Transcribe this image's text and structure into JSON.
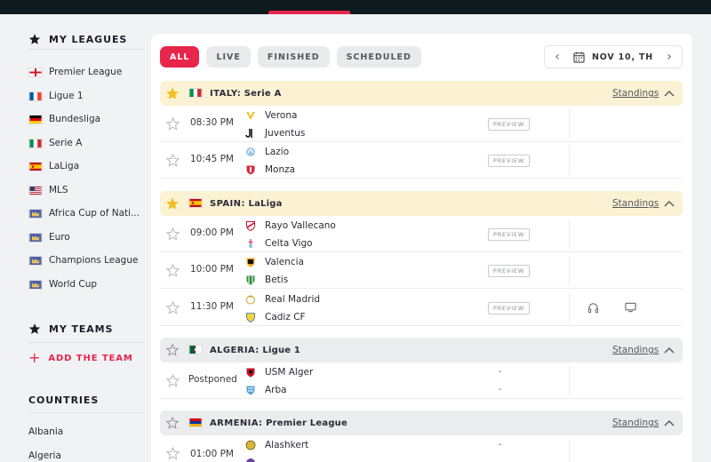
{
  "sidebar": {
    "my_leagues_title": "MY LEAGUES",
    "leagues": [
      {
        "name": "Premier League",
        "flag": "england-flag-icon"
      },
      {
        "name": "Ligue 1",
        "flag": "france-flag-icon"
      },
      {
        "name": "Bundesliga",
        "flag": "germany-flag-icon"
      },
      {
        "name": "Serie A",
        "flag": "italy-flag-icon"
      },
      {
        "name": "LaLiga",
        "flag": "spain-flag-icon"
      },
      {
        "name": "MLS",
        "flag": "usa-flag-icon"
      },
      {
        "name": "Africa Cup of Nati...",
        "flag": "world-flag-icon"
      },
      {
        "name": "Euro",
        "flag": "world-flag-icon"
      },
      {
        "name": "Champions League",
        "flag": "world-flag-icon"
      },
      {
        "name": "World Cup",
        "flag": "world-flag-icon"
      }
    ],
    "my_teams_title": "MY TEAMS",
    "add_team_label": "ADD THE TEAM",
    "countries_title": "COUNTRIES",
    "countries": [
      "Albania",
      "Algeria"
    ]
  },
  "filters": {
    "all": "ALL",
    "live": "LIVE",
    "finished": "FINISHED",
    "scheduled": "SCHEDULED",
    "date": "NOV 10, TH"
  },
  "leagues": [
    {
      "country": "ITALY:",
      "name": "Serie A",
      "standings": "Standings",
      "favorite": true,
      "flag": "italy-flag-icon",
      "matches": [
        {
          "time": "08:30 PM",
          "home": "Verona",
          "away": "Juventus",
          "preview": "PREVIEW"
        },
        {
          "time": "10:45 PM",
          "home": "Lazio",
          "away": "Monza",
          "preview": "PREVIEW"
        }
      ]
    },
    {
      "country": "SPAIN:",
      "name": "LaLiga",
      "standings": "Standings",
      "favorite": true,
      "flag": "spain-flag-icon",
      "matches": [
        {
          "time": "09:00 PM",
          "home": "Rayo Vallecano",
          "away": "Celta Vigo",
          "preview": "PREVIEW"
        },
        {
          "time": "10:00 PM",
          "home": "Valencia",
          "away": "Betis",
          "preview": "PREVIEW"
        },
        {
          "time": "11:30 PM",
          "home": "Real Madrid",
          "away": "Cadiz CF",
          "preview": "PREVIEW"
        }
      ]
    },
    {
      "country": "ALGERIA:",
      "name": "Ligue 1",
      "standings": "Standings",
      "favorite": false,
      "flag": "algeria-flag-icon",
      "matches": [
        {
          "time": "Postponed",
          "home": "USM Alger",
          "away": "Arba",
          "home_score": "-",
          "away_score": "-"
        }
      ]
    },
    {
      "country": "ARMENIA:",
      "name": "Premier League",
      "standings": "Standings",
      "favorite": false,
      "flag": "armenia-flag-icon",
      "matches": [
        {
          "time": "01:00 PM",
          "home": "Alashkert",
          "away": "",
          "home_score": "-"
        }
      ]
    }
  ],
  "colors": {
    "accent": "#e8254a",
    "favorite_bar": "#fbf2d4",
    "league_bar": "#ebeced",
    "star_gold": "#f2be22"
  }
}
